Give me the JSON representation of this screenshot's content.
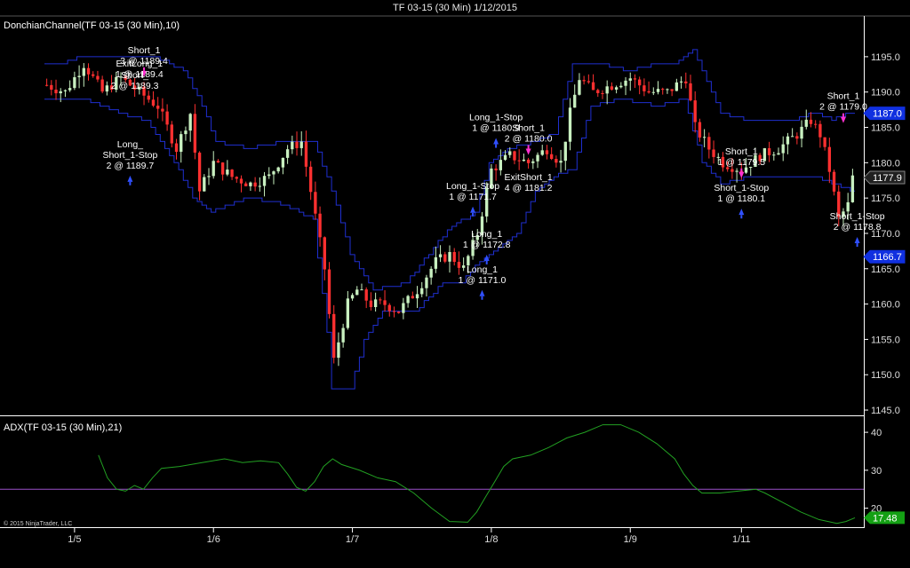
{
  "window_title": "TF 03-15 (30 Min)  1/12/2015",
  "copyright": "© 2015 NinjaTrader, LLC",
  "colors": {
    "background": "#000000",
    "channel": "#1f2fd0",
    "candle_up": "#c8f0c0",
    "candle_down": "#ff3030",
    "adx_line": "#22a022",
    "adx_threshold": "#9a50c8",
    "buy_arrow": "#3050ff",
    "sell_arrow": "#ff30d0",
    "last_price_tag": "#202020",
    "channel_tag": "#1030e0",
    "adx_tag": "#14a014"
  },
  "chart_data": [
    {
      "type": "candlestick",
      "panel": "price",
      "label": "DonchianChannel(TF 03-15 (30 Min),10)",
      "ylim": [
        1144,
        1198
      ],
      "y_ticks": [
        1145.0,
        1150.0,
        1155.0,
        1160.0,
        1165.0,
        1170.0,
        1175.0,
        1180.0,
        1185.0,
        1190.0,
        1195.0
      ],
      "x_ticks": [
        "1/5",
        "1/6",
        "1/7",
        "1/8",
        "1/9",
        "1/11"
      ],
      "x_tick_positions": [
        6,
        36,
        66,
        96,
        126,
        150
      ],
      "bar_count": 175,
      "close_path": [
        [
          0,
          1191
        ],
        [
          4,
          1190
        ],
        [
          8,
          1194
        ],
        [
          12,
          1190
        ],
        [
          16,
          1192
        ],
        [
          20,
          1190
        ],
        [
          24,
          1188
        ],
        [
          28,
          1182
        ],
        [
          31,
          1187
        ],
        [
          33,
          1176
        ],
        [
          36,
          1180
        ],
        [
          40,
          1178
        ],
        [
          44,
          1177
        ],
        [
          48,
          1178
        ],
        [
          52,
          1182
        ],
        [
          55,
          1183
        ],
        [
          57,
          1176
        ],
        [
          60,
          1165
        ],
        [
          62,
          1152
        ],
        [
          65,
          1160
        ],
        [
          67,
          1162
        ],
        [
          70,
          1160
        ],
        [
          73,
          1160
        ],
        [
          76,
          1159
        ],
        [
          80,
          1162
        ],
        [
          84,
          1166
        ],
        [
          87,
          1167
        ],
        [
          90,
          1165
        ],
        [
          93,
          1170
        ],
        [
          96,
          1179
        ],
        [
          100,
          1181
        ],
        [
          104,
          1180
        ],
        [
          108,
          1182
        ],
        [
          111,
          1180
        ],
        [
          113,
          1187
        ],
        [
          115,
          1192
        ],
        [
          118,
          1190
        ],
        [
          122,
          1191
        ],
        [
          126,
          1192
        ],
        [
          130,
          1190
        ],
        [
          134,
          1190
        ],
        [
          138,
          1192
        ],
        [
          140,
          1185
        ],
        [
          143,
          1182
        ],
        [
          146,
          1180
        ],
        [
          150,
          1179
        ],
        [
          154,
          1181
        ],
        [
          158,
          1182
        ],
        [
          162,
          1184
        ],
        [
          165,
          1186
        ],
        [
          167,
          1184
        ],
        [
          169,
          1179
        ],
        [
          171,
          1172
        ],
        [
          173,
          1174
        ],
        [
          174,
          1177.9
        ]
      ],
      "upper_channel": [
        [
          0,
          1194
        ],
        [
          4,
          1194
        ],
        [
          8,
          1195
        ],
        [
          16,
          1195
        ],
        [
          24,
          1195
        ],
        [
          30,
          1193
        ],
        [
          34,
          1188
        ],
        [
          37,
          1183
        ],
        [
          44,
          1182
        ],
        [
          52,
          1183
        ],
        [
          58,
          1183
        ],
        [
          62,
          1176
        ],
        [
          66,
          1167
        ],
        [
          71,
          1162
        ],
        [
          78,
          1163
        ],
        [
          84,
          1168
        ],
        [
          88,
          1171
        ],
        [
          93,
          1173
        ],
        [
          96,
          1180
        ],
        [
          100,
          1182
        ],
        [
          106,
          1183
        ],
        [
          110,
          1184
        ],
        [
          114,
          1194
        ],
        [
          120,
          1194
        ],
        [
          126,
          1193
        ],
        [
          132,
          1194
        ],
        [
          136,
          1194
        ],
        [
          140,
          1196
        ],
        [
          146,
          1187
        ],
        [
          152,
          1186
        ],
        [
          158,
          1186
        ],
        [
          162,
          1186
        ],
        [
          166,
          1187
        ],
        [
          170,
          1186
        ],
        [
          174,
          1187
        ]
      ],
      "lower_channel": [
        [
          0,
          1189
        ],
        [
          8,
          1189
        ],
        [
          16,
          1187
        ],
        [
          22,
          1186
        ],
        [
          28,
          1180
        ],
        [
          32,
          1175
        ],
        [
          36,
          1173
        ],
        [
          44,
          1175
        ],
        [
          52,
          1174
        ],
        [
          58,
          1172
        ],
        [
          61,
          1156
        ],
        [
          62,
          1148
        ],
        [
          66,
          1148
        ],
        [
          69,
          1155
        ],
        [
          73,
          1159
        ],
        [
          80,
          1159
        ],
        [
          86,
          1163
        ],
        [
          90,
          1163
        ],
        [
          94,
          1166
        ],
        [
          98,
          1168
        ],
        [
          102,
          1170
        ],
        [
          106,
          1176
        ],
        [
          110,
          1178
        ],
        [
          114,
          1179
        ],
        [
          118,
          1188
        ],
        [
          124,
          1189
        ],
        [
          132,
          1188
        ],
        [
          138,
          1189
        ],
        [
          142,
          1180
        ],
        [
          146,
          1177
        ],
        [
          152,
          1178
        ],
        [
          160,
          1178
        ],
        [
          166,
          1178
        ],
        [
          170,
          1177
        ],
        [
          174,
          1176
        ]
      ],
      "price_tags": [
        {
          "value": 1187.0,
          "kind": "channel",
          "text": "1187.0"
        },
        {
          "value": 1177.9,
          "kind": "last",
          "text": "1177.9"
        },
        {
          "value": 1166.7,
          "kind": "channel",
          "text": "1166.7"
        }
      ],
      "annotations": [
        {
          "bar": 21,
          "price": 1195.5,
          "side": "sell",
          "lines": [
            "Short_1",
            "3 @ 1189.4"
          ]
        },
        {
          "bar": 20,
          "price": 1193.6,
          "side": "none",
          "lines": [
            "ExitLong_1",
            "1 @ 1189.4"
          ]
        },
        {
          "bar": 19,
          "price": 1192.0,
          "side": "none",
          "lines": [
            "Short_",
            "2 @ 1189.3"
          ]
        },
        {
          "bar": 18,
          "price": 1182.2,
          "side": "buy",
          "lines": [
            "Long_",
            "Short_1-Stop",
            "2 @ 1189.7"
          ]
        },
        {
          "bar": 97,
          "price": 1186.0,
          "side": "buy",
          "lines": [
            "Long_1-Stop",
            "1 @ 1180.9"
          ]
        },
        {
          "bar": 104,
          "price": 1184.5,
          "side": "sell",
          "lines": [
            "Short_1",
            "2 @ 1180.0"
          ]
        },
        {
          "bar": 104,
          "price": 1177.5,
          "side": "none",
          "lines": [
            "ExitShort_1",
            "4 @ 1181.2"
          ]
        },
        {
          "bar": 92,
          "price": 1176.3,
          "side": "buy",
          "lines": [
            "Long_1-Stop",
            "1 @ 1171.7"
          ]
        },
        {
          "bar": 95,
          "price": 1169.5,
          "side": "buy",
          "lines": [
            "Long_1",
            "1 @ 1172.8"
          ]
        },
        {
          "bar": 94,
          "price": 1164.5,
          "side": "buy",
          "lines": [
            "Long_1",
            "1 @ 1171.0"
          ]
        },
        {
          "bar": 150,
          "price": 1181.2,
          "side": "sell",
          "lines": [
            "Short_1",
            "1 @ 1179.5"
          ]
        },
        {
          "bar": 150,
          "price": 1176.0,
          "side": "buy",
          "lines": [
            "Short_1-Stop",
            "1 @ 1180.1"
          ]
        },
        {
          "bar": 172,
          "price": 1189.0,
          "side": "sell",
          "lines": [
            "Short_1",
            "2 @ 1179.0"
          ]
        },
        {
          "bar": 175,
          "price": 1172.0,
          "side": "buy",
          "lines": [
            "Short_1-Stop",
            "2 @ 1178.8"
          ]
        }
      ]
    },
    {
      "type": "line",
      "panel": "indicator",
      "label": "ADX(TF 03-15 (30 Min),21)",
      "ylim": [
        15,
        44
      ],
      "y_ticks": [
        20,
        30,
        40
      ],
      "threshold": 25,
      "last_value_text": "17.48",
      "series": [
        {
          "points": [
            [
              12,
              34
            ],
            [
              14,
              28
            ],
            [
              16,
              25
            ],
            [
              18,
              24.5
            ],
            [
              20,
              26
            ],
            [
              22,
              25
            ],
            [
              24,
              28
            ],
            [
              26,
              30.5
            ],
            [
              30,
              31
            ],
            [
              35,
              32
            ],
            [
              40,
              33
            ],
            [
              44,
              32
            ],
            [
              48,
              32.5
            ],
            [
              52,
              32
            ],
            [
              54,
              29
            ],
            [
              56,
              25.5
            ],
            [
              58,
              24.5
            ],
            [
              60,
              27
            ],
            [
              62,
              31
            ],
            [
              64,
              33
            ],
            [
              66,
              31.5
            ],
            [
              70,
              30
            ],
            [
              74,
              28
            ],
            [
              78,
              27
            ],
            [
              82,
              24
            ],
            [
              86,
              20
            ],
            [
              90,
              16.5
            ],
            [
              94,
              16.3
            ],
            [
              96,
              19
            ],
            [
              98,
              23
            ],
            [
              100,
              27
            ],
            [
              102,
              31
            ],
            [
              104,
              33
            ],
            [
              108,
              34
            ],
            [
              112,
              36
            ],
            [
              116,
              38.5
            ],
            [
              120,
              40
            ],
            [
              124,
              42
            ],
            [
              128,
              42
            ],
            [
              132,
              40
            ],
            [
              136,
              37
            ],
            [
              140,
              33
            ],
            [
              142,
              29
            ],
            [
              144,
              26
            ],
            [
              146,
              24
            ],
            [
              150,
              24
            ],
            [
              154,
              24.5
            ],
            [
              158,
              25
            ],
            [
              160,
              24
            ],
            [
              164,
              21.5
            ],
            [
              168,
              19
            ],
            [
              172,
              17
            ],
            [
              176,
              16
            ],
            [
              178,
              16.5
            ],
            [
              180,
              17.48
            ]
          ]
        }
      ]
    }
  ]
}
